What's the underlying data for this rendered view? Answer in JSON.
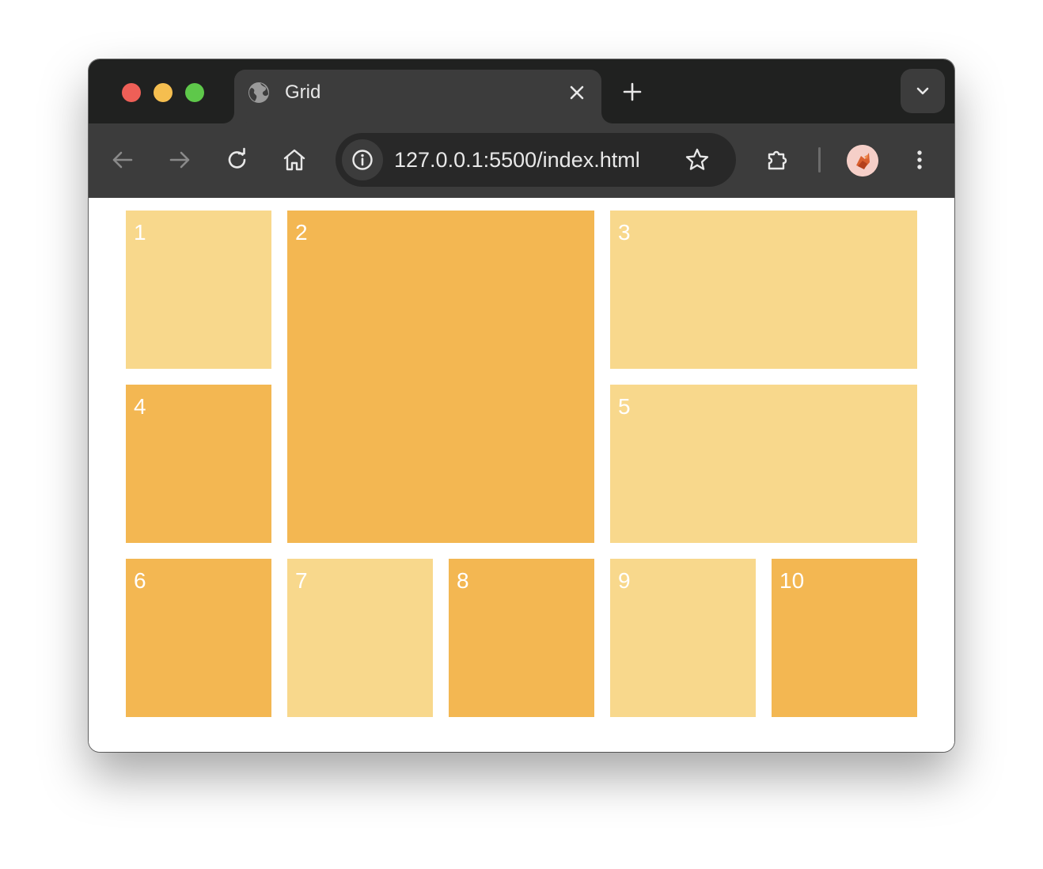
{
  "tab": {
    "title": "Grid",
    "favicon_icon": "globe-icon",
    "close_icon": "close-icon"
  },
  "tabstrip": {
    "new_tab_icon": "plus-icon",
    "dropdown_icon": "chevron-down-icon"
  },
  "toolbar": {
    "back_icon": "arrow-left-icon",
    "forward_icon": "arrow-right-icon",
    "reload_icon": "reload-icon",
    "home_icon": "home-icon",
    "site_info_icon": "info-icon",
    "url": "127.0.0.1:5500/index.html",
    "bookmark_icon": "star-icon",
    "extensions_icon": "puzzle-icon",
    "profile_icon": "avatar",
    "menu_icon": "kebab-menu-icon"
  },
  "window_controls": {
    "close_color": "#ee5f57",
    "minimize_color": "#f5be4f",
    "zoom_color": "#5ec84a"
  },
  "colors": {
    "light_cell": "#f8d88c",
    "dark_cell": "#f3b752",
    "tabstrip_bg": "#202120",
    "toolbar_bg": "#3c3c3c"
  },
  "grid": {
    "items": [
      {
        "label": "1",
        "tone": "light"
      },
      {
        "label": "2",
        "tone": "dark"
      },
      {
        "label": "3",
        "tone": "light"
      },
      {
        "label": "4",
        "tone": "dark"
      },
      {
        "label": "5",
        "tone": "light"
      },
      {
        "label": "6",
        "tone": "dark"
      },
      {
        "label": "7",
        "tone": "light"
      },
      {
        "label": "8",
        "tone": "dark"
      },
      {
        "label": "9",
        "tone": "light"
      },
      {
        "label": "10",
        "tone": "dark"
      }
    ]
  }
}
